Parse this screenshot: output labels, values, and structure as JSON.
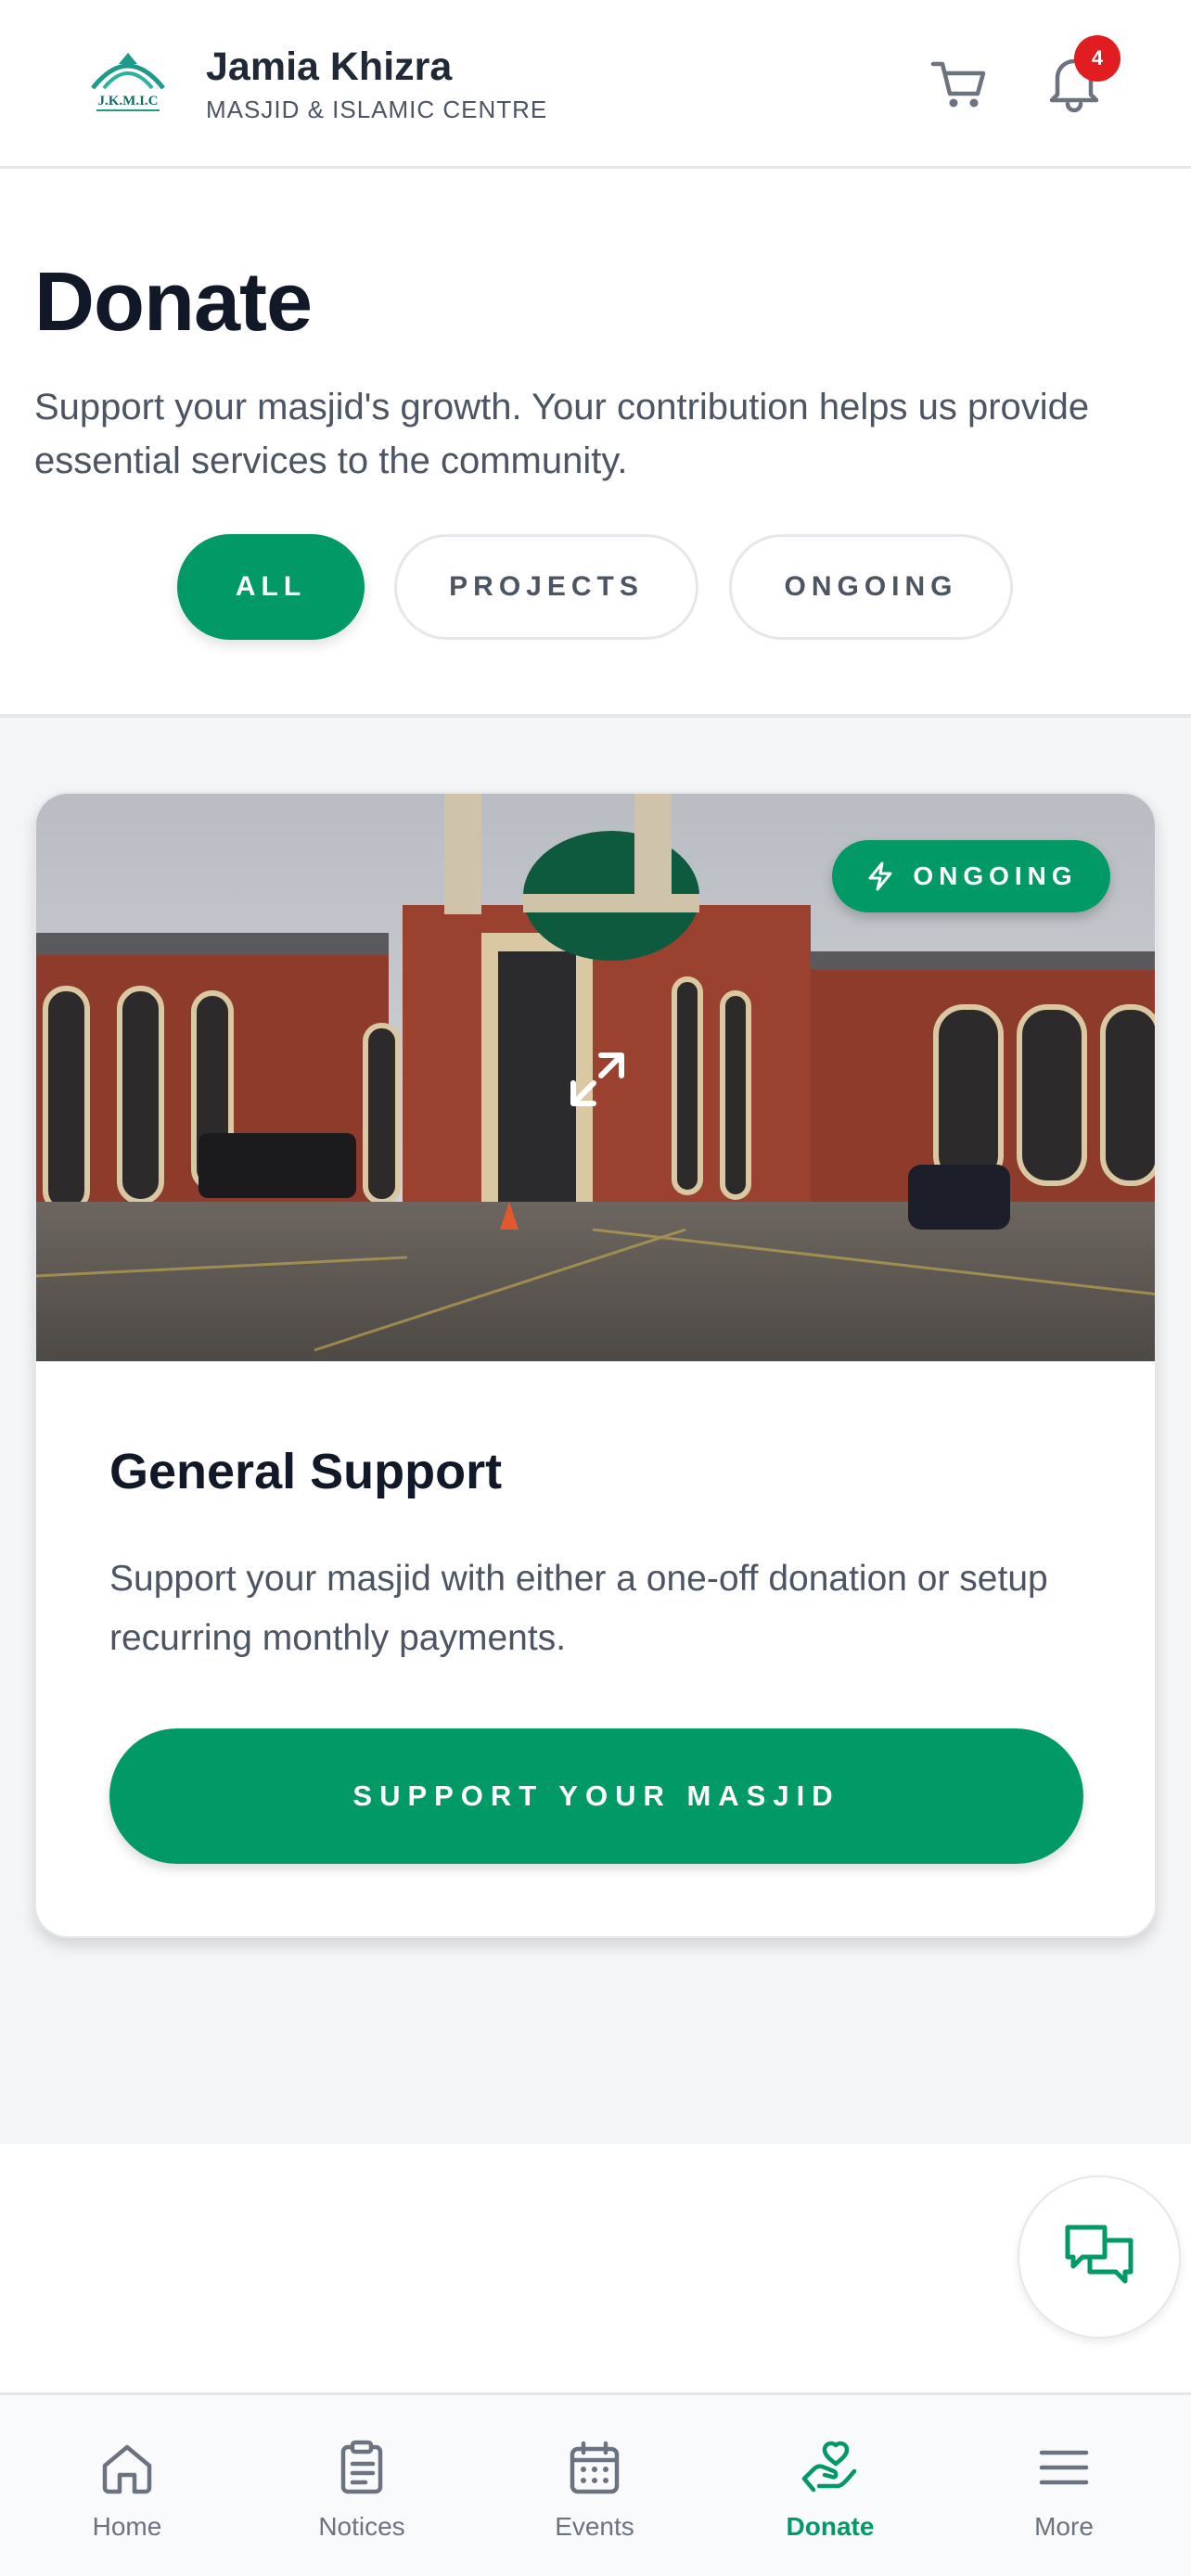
{
  "header": {
    "logo_text": "J.K.M.I.C",
    "brand_name": "Jamia Khizra",
    "brand_subtitle": "MASJID & ISLAMIC CENTRE",
    "notification_count": "4",
    "cart_icon": "cart-icon",
    "bell_icon": "bell-icon"
  },
  "page": {
    "title": "Donate",
    "intro": "Support your masjid's growth. Your contribution helps us provide essential services to the community."
  },
  "filters": [
    {
      "label": "ALL",
      "selected": true
    },
    {
      "label": "PROJECTS",
      "selected": false
    },
    {
      "label": "ONGOING",
      "selected": false
    }
  ],
  "card": {
    "badge_label": "ONGOING",
    "badge_icon": "lightning-icon",
    "image_subject": "masjid-building-photo",
    "title": "General Support",
    "description": "Support your masjid with either a one-off donation or setup recurring monthly payments.",
    "button_label": "SUPPORT YOUR MASJID"
  },
  "chat": {
    "icon": "chat-icon"
  },
  "bottom_nav": [
    {
      "label": "Home",
      "icon": "home-icon",
      "active": false
    },
    {
      "label": "Notices",
      "icon": "clipboard-icon",
      "active": false
    },
    {
      "label": "Events",
      "icon": "calendar-icon",
      "active": false
    },
    {
      "label": "Donate",
      "icon": "hand-heart-icon",
      "active": true
    },
    {
      "label": "More",
      "icon": "menu-icon",
      "active": false
    }
  ],
  "colors": {
    "accent": "#019966",
    "badge_red": "#e11d22",
    "text_dark": "#111827",
    "text_muted": "#4b5563",
    "content_bg": "#f4f5f7"
  }
}
